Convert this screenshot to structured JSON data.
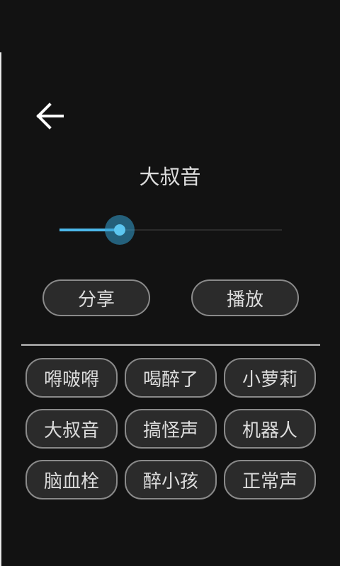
{
  "header": {
    "back_icon": "arrow-left-icon",
    "title": "大叔音"
  },
  "slider": {
    "value_percent": 27,
    "accent_color": "#4cb8ea"
  },
  "actions": {
    "share_label": "分享",
    "play_label": "播放"
  },
  "effects": [
    "嘚啵嘚",
    "喝醉了",
    "小萝莉",
    "大叔音",
    "搞怪声",
    "机器人",
    "脑血栓",
    "醉小孩",
    "正常声"
  ]
}
